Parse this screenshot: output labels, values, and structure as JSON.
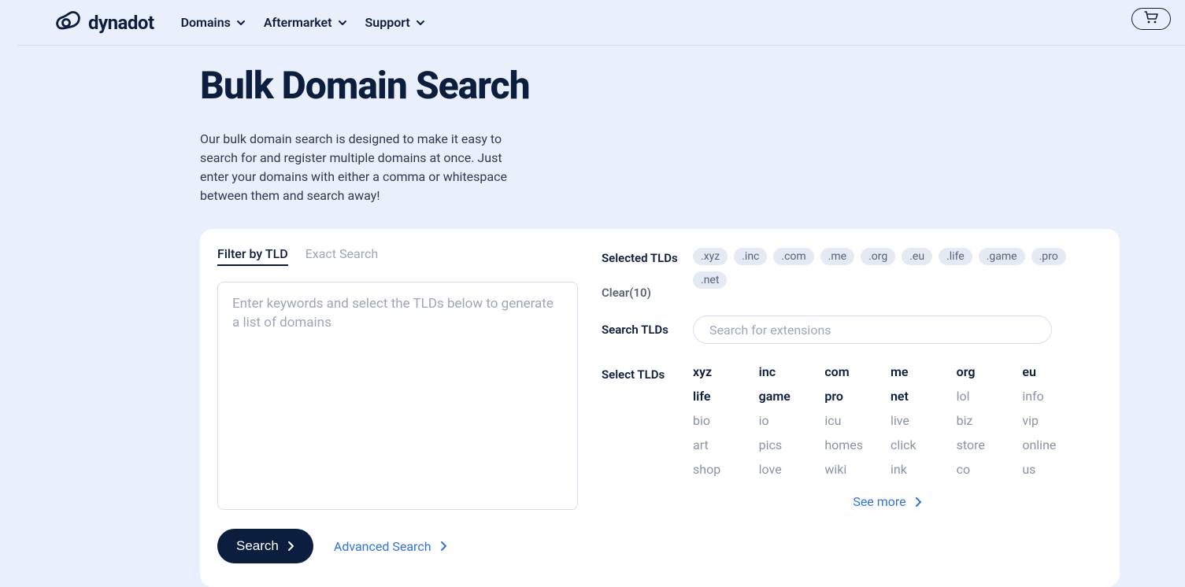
{
  "header": {
    "brand": "dynadot",
    "nav": [
      "Domains",
      "Aftermarket",
      "Support"
    ]
  },
  "page": {
    "title": "Bulk Domain Search",
    "description": "Our bulk domain search is designed to make it easy to search for and register multiple domains at once. Just enter your domains with either a comma or whitespace between them and search away!"
  },
  "tabs": {
    "filter": "Filter by TLD",
    "exact": "Exact Search"
  },
  "keyword_placeholder": "Enter keywords and select the TLDs below to generate a list of domains",
  "actions": {
    "search": "Search",
    "advanced": "Advanced Search"
  },
  "selected": {
    "label": "Selected TLDs",
    "pills": [
      ".xyz",
      ".inc",
      ".com",
      ".me",
      ".org",
      ".eu",
      ".life",
      ".game",
      ".pro",
      ".net"
    ],
    "clear": "Clear(10)"
  },
  "search_tlds": {
    "label": "Search TLDs",
    "placeholder": "Search for extensions"
  },
  "select_tlds": {
    "label": "Select TLDs",
    "grid": [
      {
        "t": "xyz",
        "s": true
      },
      {
        "t": "inc",
        "s": true
      },
      {
        "t": "com",
        "s": true
      },
      {
        "t": "me",
        "s": true
      },
      {
        "t": "org",
        "s": true
      },
      {
        "t": "eu",
        "s": true
      },
      {
        "t": "life",
        "s": true
      },
      {
        "t": "game",
        "s": true
      },
      {
        "t": "pro",
        "s": true
      },
      {
        "t": "net",
        "s": true
      },
      {
        "t": "lol",
        "s": false
      },
      {
        "t": "info",
        "s": false
      },
      {
        "t": "bio",
        "s": false
      },
      {
        "t": "io",
        "s": false
      },
      {
        "t": "icu",
        "s": false
      },
      {
        "t": "live",
        "s": false
      },
      {
        "t": "biz",
        "s": false
      },
      {
        "t": "vip",
        "s": false
      },
      {
        "t": "art",
        "s": false
      },
      {
        "t": "pics",
        "s": false
      },
      {
        "t": "homes",
        "s": false
      },
      {
        "t": "click",
        "s": false
      },
      {
        "t": "store",
        "s": false
      },
      {
        "t": "online",
        "s": false
      },
      {
        "t": "shop",
        "s": false
      },
      {
        "t": "love",
        "s": false
      },
      {
        "t": "wiki",
        "s": false
      },
      {
        "t": "ink",
        "s": false
      },
      {
        "t": "co",
        "s": false
      },
      {
        "t": "us",
        "s": false
      }
    ],
    "see_more": "See more"
  }
}
